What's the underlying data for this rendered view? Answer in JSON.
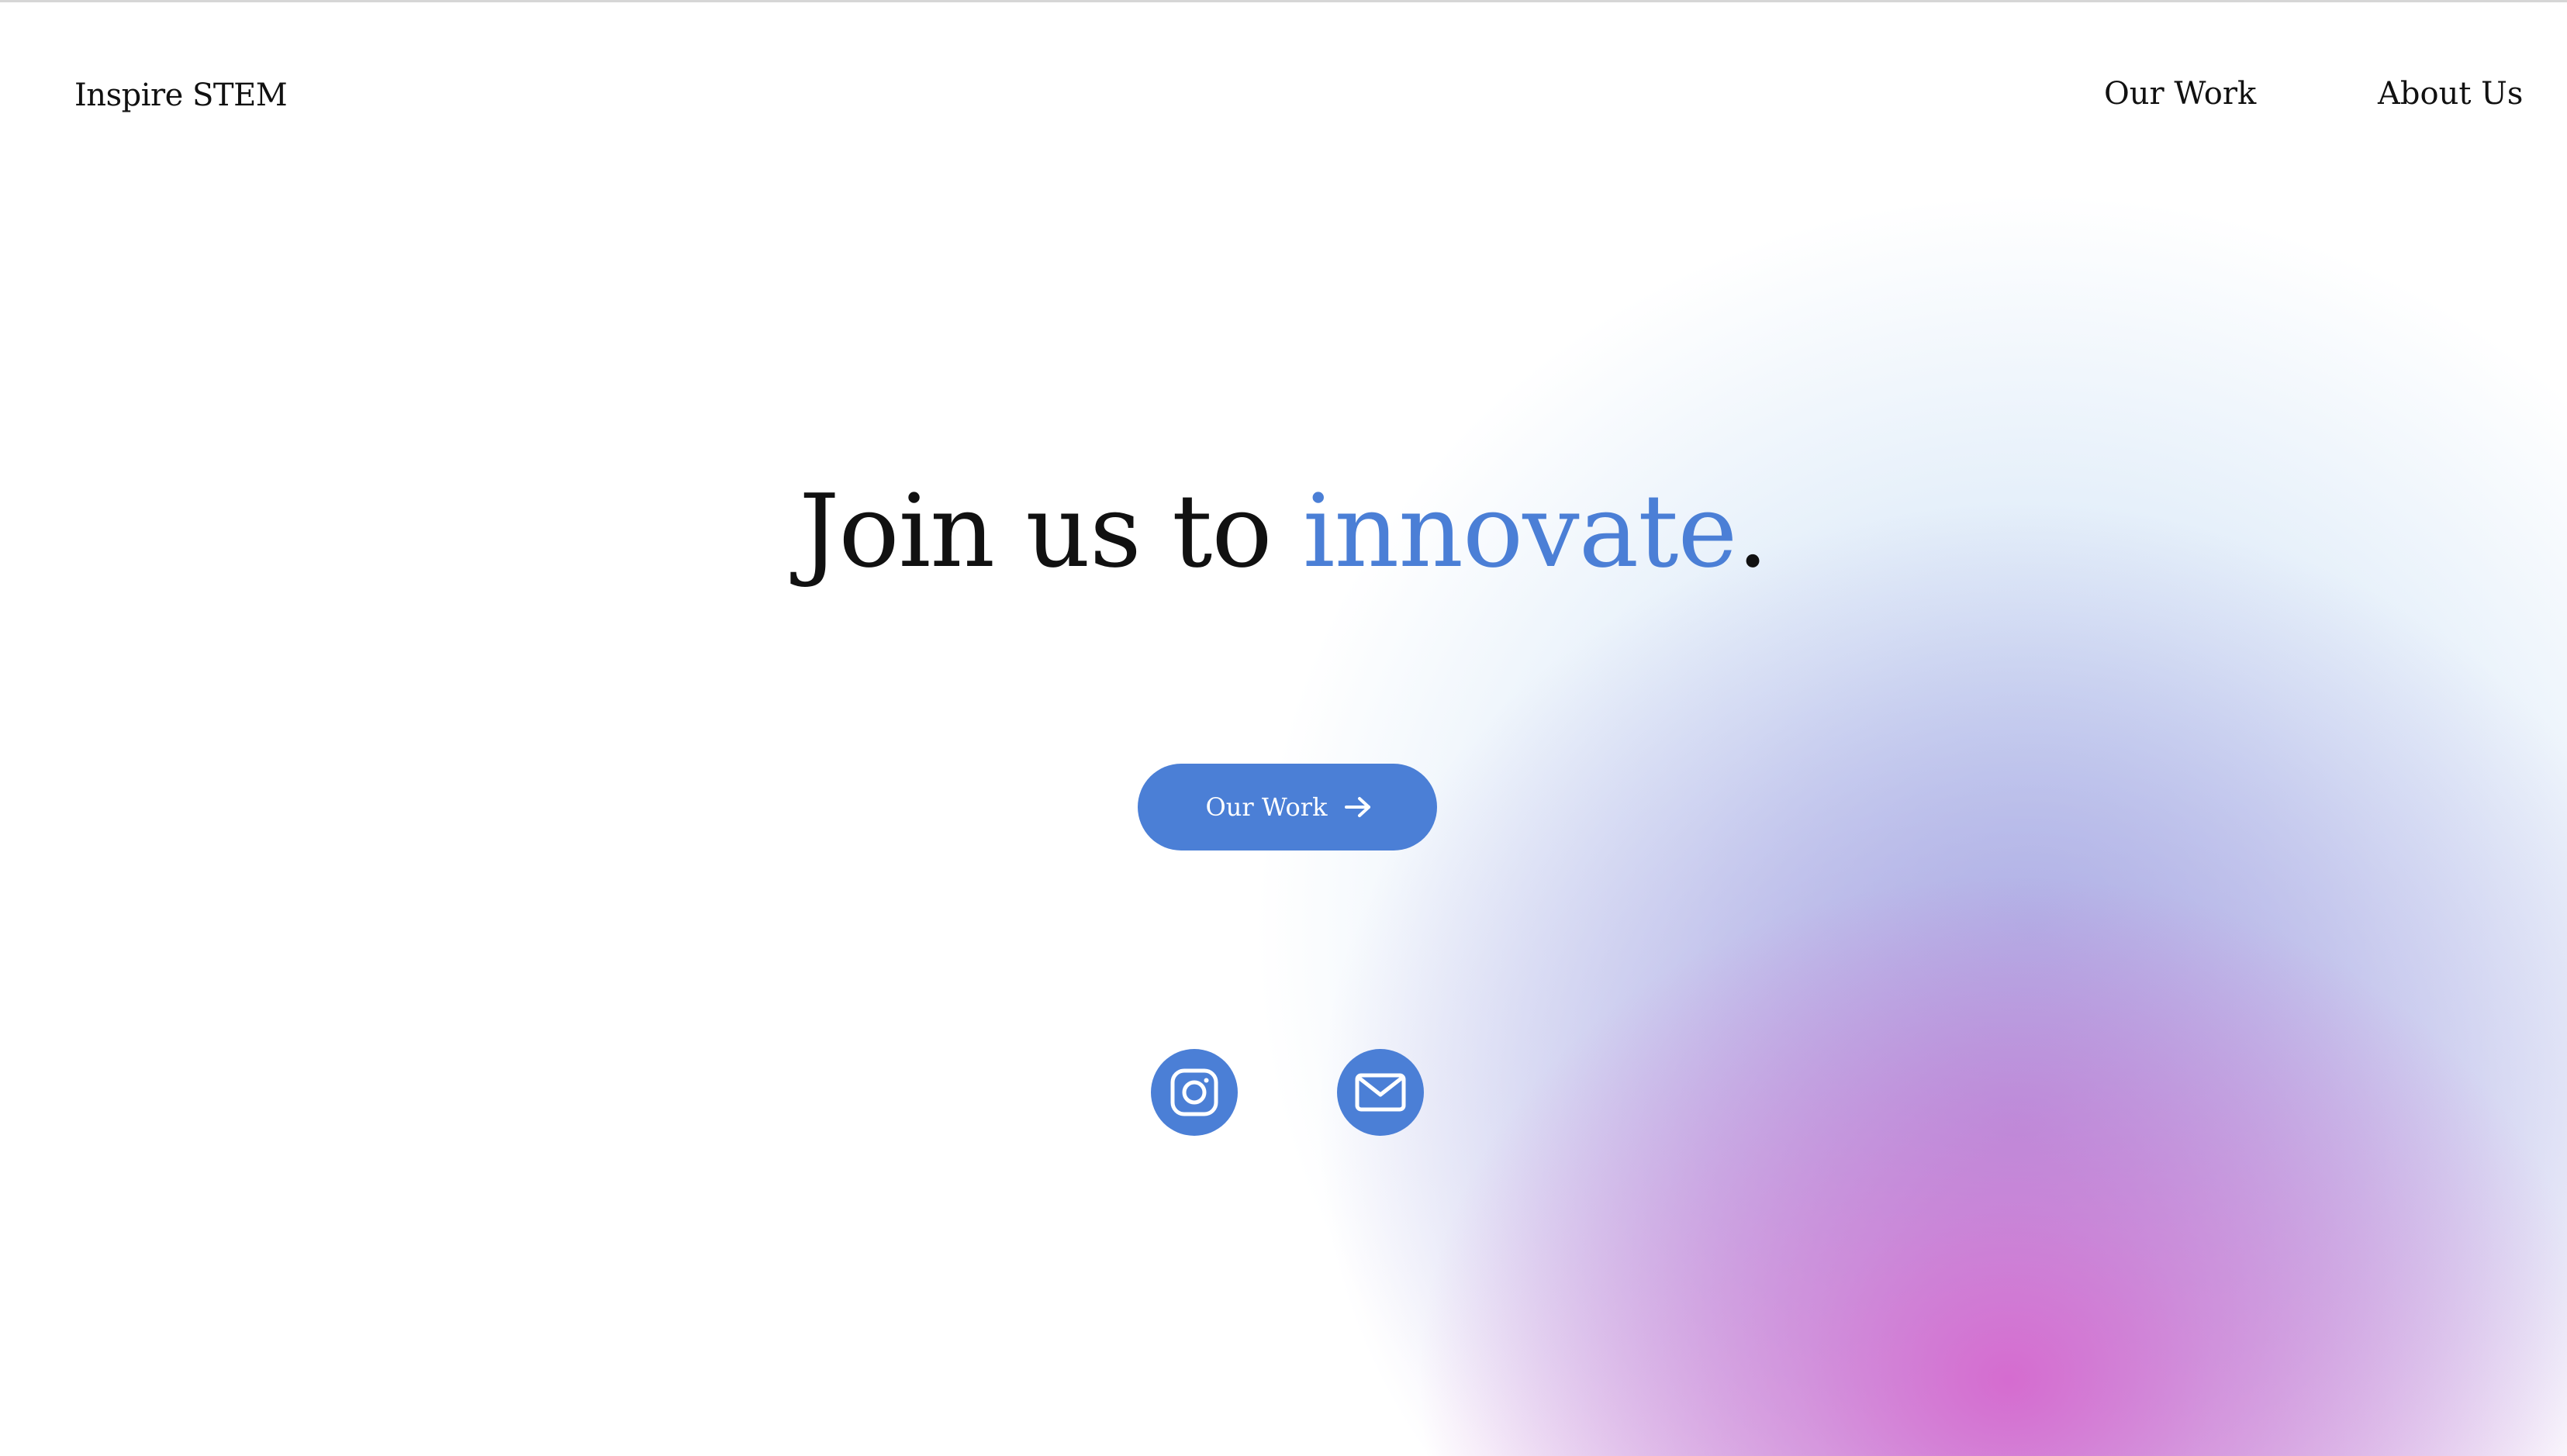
{
  "header": {
    "brand": "Inspire STEM",
    "nav": [
      {
        "label": "Our Work"
      },
      {
        "label": "About Us"
      }
    ]
  },
  "hero": {
    "headline_main": "Join us to ",
    "headline_accent": "innovate",
    "headline_end": ".",
    "cta_label": "Our Work",
    "cta_icon": "arrow-right-icon"
  },
  "social": [
    {
      "icon": "instagram-icon"
    },
    {
      "icon": "mail-icon"
    }
  ],
  "colors": {
    "accent": "#4b7fd6",
    "text": "#111111",
    "background": "#ffffff",
    "gradient_blue": "#a0c3eb",
    "gradient_lavender": "#aa96dc",
    "gradient_pink": "#d667ce"
  }
}
